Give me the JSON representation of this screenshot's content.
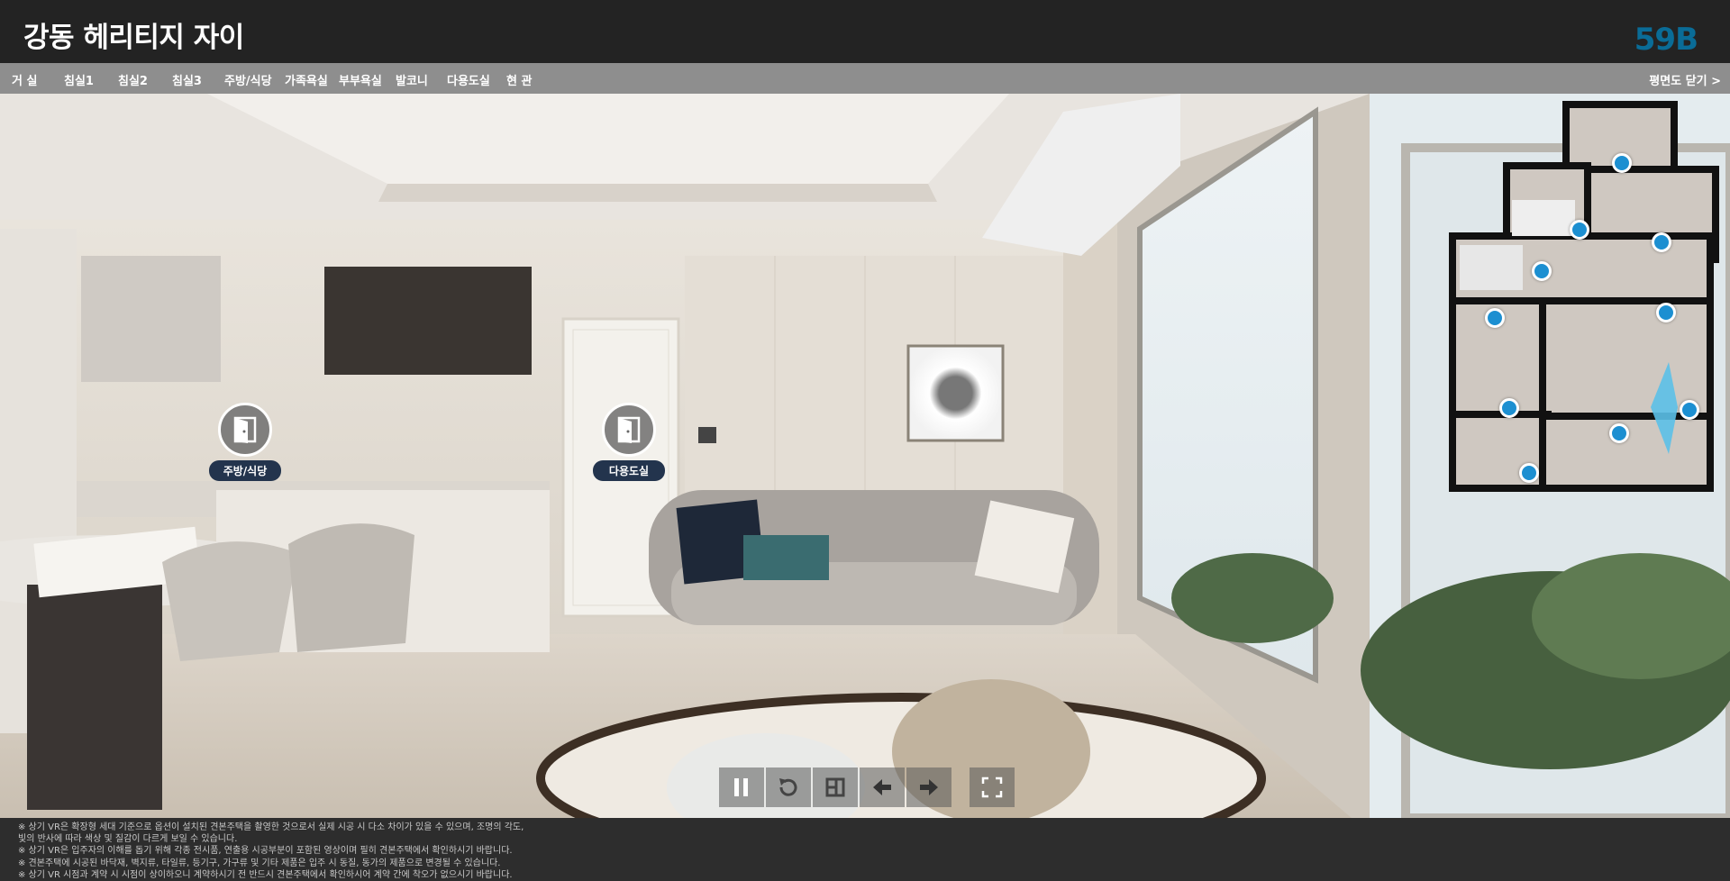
{
  "header": {
    "title": "강동 헤리티지 자이",
    "unit_type": "59B"
  },
  "nav": {
    "items": [
      {
        "label": "거 실"
      },
      {
        "label": "침실1"
      },
      {
        "label": "침실2"
      },
      {
        "label": "침실3"
      },
      {
        "label": "주방/식당"
      },
      {
        "label": "가족욕실"
      },
      {
        "label": "부부욕실"
      },
      {
        "label": "발코니"
      },
      {
        "label": "다용도실"
      },
      {
        "label": "현 관"
      }
    ],
    "close_plan_label": "평면도 닫기 >"
  },
  "hotspots": [
    {
      "label": "주방/식당",
      "icon": "door-icon"
    },
    {
      "label": "다용도실",
      "icon": "door-icon"
    }
  ],
  "floor_plan": {
    "pin_count": 10,
    "active_view_cone_color": "#5bc0e8",
    "pin_color": "#1c8fd1"
  },
  "controls": [
    {
      "name": "pause-button",
      "icon": "pause-icon"
    },
    {
      "name": "reset-view-button",
      "icon": "reset-icon"
    },
    {
      "name": "floorplan-view-button",
      "icon": "layout-icon"
    },
    {
      "name": "prev-button",
      "icon": "arrow-left-icon"
    },
    {
      "name": "next-button",
      "icon": "arrow-right-icon"
    },
    {
      "name": "fullscreen-button",
      "icon": "fullscreen-icon"
    }
  ],
  "disclaimer": [
    "※ 상기 VR은 확장형 세대 기준으로 옵션이 설치된 견본주택을 촬영한 것으로서 실제 시공 시 다소 차이가 있을 수 있으며, 조명의 각도,",
    "빛의 반사에 따라 색상 및 질감이 다르게 보일 수 있습니다.",
    "※ 상기 VR은 입주자의 이해를 돕기 위해 각종 전시품, 연출용 시공부분이 포함된 영상이며 필히 견본주택에서 확인하시기 바랍니다.",
    "※ 견본주택에 시공된 바닥재, 벽지류, 타일류, 등기구, 가구류 및 기타 제품은 입주 시 동질, 동가의 제품으로 변경될 수 있습니다.",
    "※ 상기 VR 시점과 계약 시 시점이 상이하오니 계약하시기 전 반드시 견본주택에서 확인하시어 계약 간에 착오가 없으시기 바랍니다."
  ],
  "colors": {
    "header_bg": "#232323",
    "accent_unit": "#0a6c97",
    "nav_bg": "#8e8e8e",
    "hotspot_tag": "#23344d"
  }
}
